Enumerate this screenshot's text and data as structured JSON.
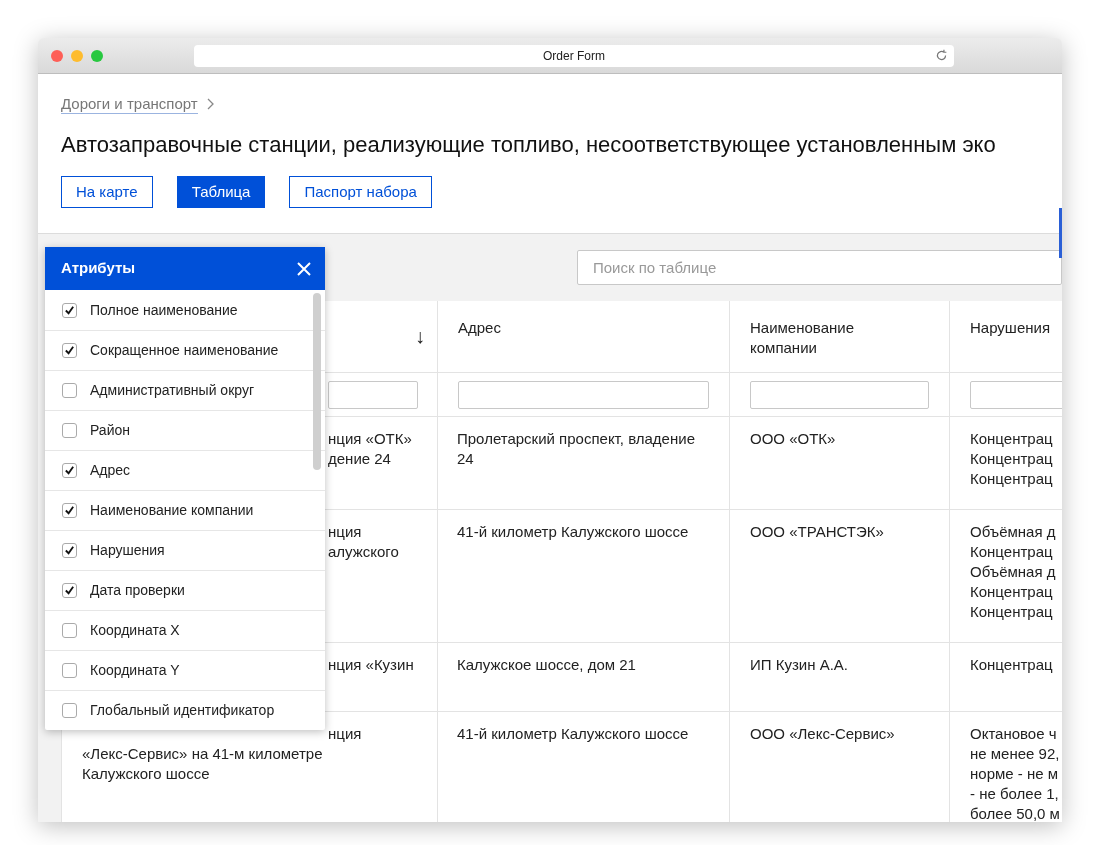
{
  "window": {
    "title": "Order Form"
  },
  "breadcrumb": {
    "label": "Дороги и транспорт"
  },
  "heading": "Автозаправочные станции, реализующие топливо, несоответствующее установленным эко",
  "view_tabs": [
    {
      "label": "На карте",
      "selected": false
    },
    {
      "label": "Таблица",
      "selected": true
    },
    {
      "label": "Паспорт набора",
      "selected": false
    }
  ],
  "search": {
    "placeholder": "Поиск по таблице"
  },
  "table": {
    "columns": [
      {
        "sort_mark": "↓"
      },
      {
        "label": "Адрес"
      },
      {
        "label": "Наименование компании"
      },
      {
        "label": "Нарушения"
      }
    ],
    "rows": [
      {
        "name": {
          "cut": [
            "нция «ОТК»",
            "дение 24"
          ]
        },
        "address": "Пролетарский проспект, владение 24",
        "company": "ООО «ОТК»",
        "violations": [
          "Концентрац",
          "Концентрац",
          "Концентрац"
        ]
      },
      {
        "name": {
          "cut": [
            "нция",
            "алужского"
          ]
        },
        "address": "41-й километр Калужского шоссе",
        "company": "ООО «ТРАНСТЭК»",
        "violations": [
          "Объёмная д",
          "Концентрац",
          "Объёмная д",
          "Концентрац",
          "Концентрац"
        ]
      },
      {
        "name": {
          "cut": [
            "нция «Кузин"
          ]
        },
        "address": "Калужское шоссе, дом 21",
        "company": "ИП Кузин А.А.",
        "violations": [
          "Концентрац"
        ]
      },
      {
        "name": {
          "cut": [
            "нция"
          ],
          "full": [
            "«Лекс-Сервис» на 41-м километре",
            "Калужского шоссе"
          ]
        },
        "address": "41-й километр Калужского шоссе",
        "company": "ООО «Лекс-Сервис»",
        "violations": [
          "Октановое ч",
          "не менее 92,",
          "норме - не м",
          "- не более 1,",
          "более 50,0 м"
        ]
      }
    ]
  },
  "attributes_panel": {
    "title": "Атрибуты",
    "items": [
      {
        "label": "Полное наименование",
        "checked": true
      },
      {
        "label": "Сокращенное наименование",
        "checked": true
      },
      {
        "label": "Административный округ",
        "checked": false
      },
      {
        "label": "Район",
        "checked": false
      },
      {
        "label": "Адрес",
        "checked": true
      },
      {
        "label": "Наименование компании",
        "checked": true
      },
      {
        "label": "Нарушения",
        "checked": true
      },
      {
        "label": "Дата проверки",
        "checked": true
      },
      {
        "label": "Координата X",
        "checked": false
      },
      {
        "label": "Координата Y",
        "checked": false
      },
      {
        "label": "Глобальный идентификатор",
        "checked": false
      }
    ]
  }
}
